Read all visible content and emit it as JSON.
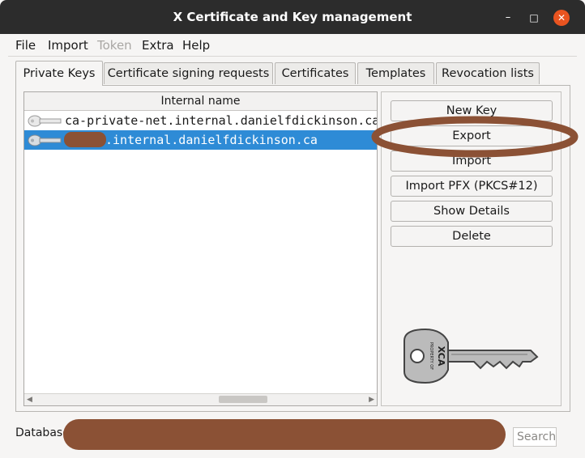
{
  "window": {
    "title": "X Certificate and Key management"
  },
  "titlebar_controls": {
    "minimize": "–",
    "maximize": "□",
    "close": "✕"
  },
  "menu": [
    "File",
    "Import",
    "Token",
    "Extra",
    "Help"
  ],
  "menu_disabled": [
    "Token"
  ],
  "tabs": [
    "Private Keys",
    "Certificate signing requests",
    "Certificates",
    "Templates",
    "Revocation lists"
  ],
  "active_tab": "Private Keys",
  "keys_list": {
    "column_header": "Internal name",
    "rows": [
      {
        "name": "ca-private-net.internal.danielfdickinson.ca",
        "selected": false
      },
      {
        "name": ".internal.danielfdickinson.ca",
        "selected": true
      }
    ]
  },
  "buttons": [
    "New Key",
    "Export",
    "Import",
    "Import PFX (PKCS#12)",
    "Show Details",
    "Delete"
  ],
  "key_logo": {
    "line1": "PROPERTY OF",
    "line2": "XCA"
  },
  "status_bar": {
    "database_label": "Database",
    "search_placeholder": "Search"
  },
  "colors": {
    "titlebar": "#2c2c2c",
    "close_button": "#e95420",
    "selection": "#2e8bd6",
    "annotation": "#8b5135"
  }
}
